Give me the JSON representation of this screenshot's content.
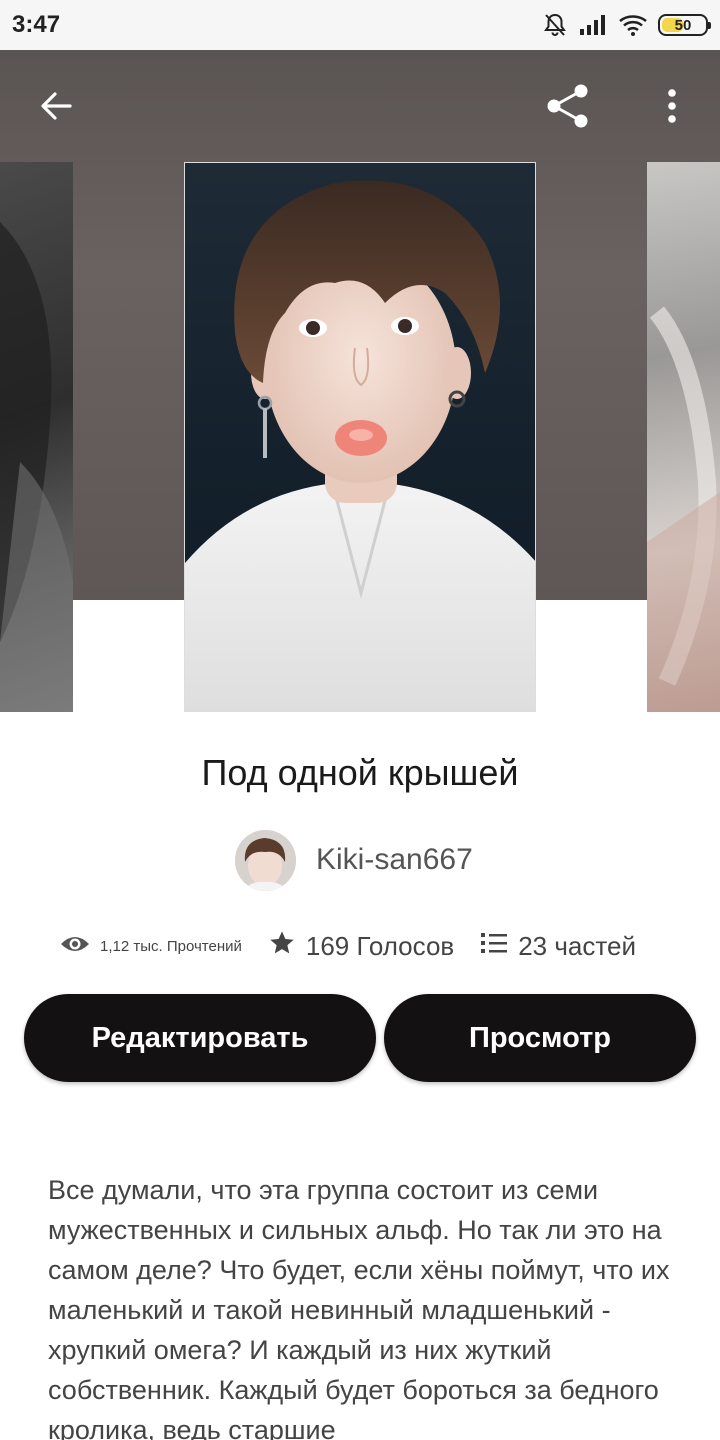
{
  "status_bar": {
    "time": "3:47",
    "icons": [
      "bell-muted-icon",
      "signal-icon",
      "wifi-icon",
      "battery-icon"
    ],
    "battery_percent": "50",
    "battery_level": 0.5,
    "battery_color": "#f2d64b"
  },
  "toolbar": {
    "icons": [
      "back-arrow-icon",
      "share-icon",
      "more-vertical-icon"
    ],
    "background_color": "#5f5856"
  },
  "story": {
    "title": "Под одной крышей",
    "author": "Kiki-san667",
    "stats": {
      "reads": "1,12 тыс. Прочтений",
      "votes": "169 Голосов",
      "parts": "23 частей"
    },
    "stats_icons": [
      "eye-icon",
      "star-icon",
      "list-icon"
    ],
    "description": "Все думали, что эта группа состоит из семи мужественных и сильных альф. Но так ли это на самом деле? Что будет, если хёны поймут, что их маленький и такой невинный младшенький - хрупкий омега? И каждый из них жуткий собственник. Каждый будет бороться за бедного кролика, ведь старшие"
  },
  "actions": {
    "edit_label": "Редактировать",
    "view_label": "Просмотр",
    "button_color": "#141112"
  }
}
